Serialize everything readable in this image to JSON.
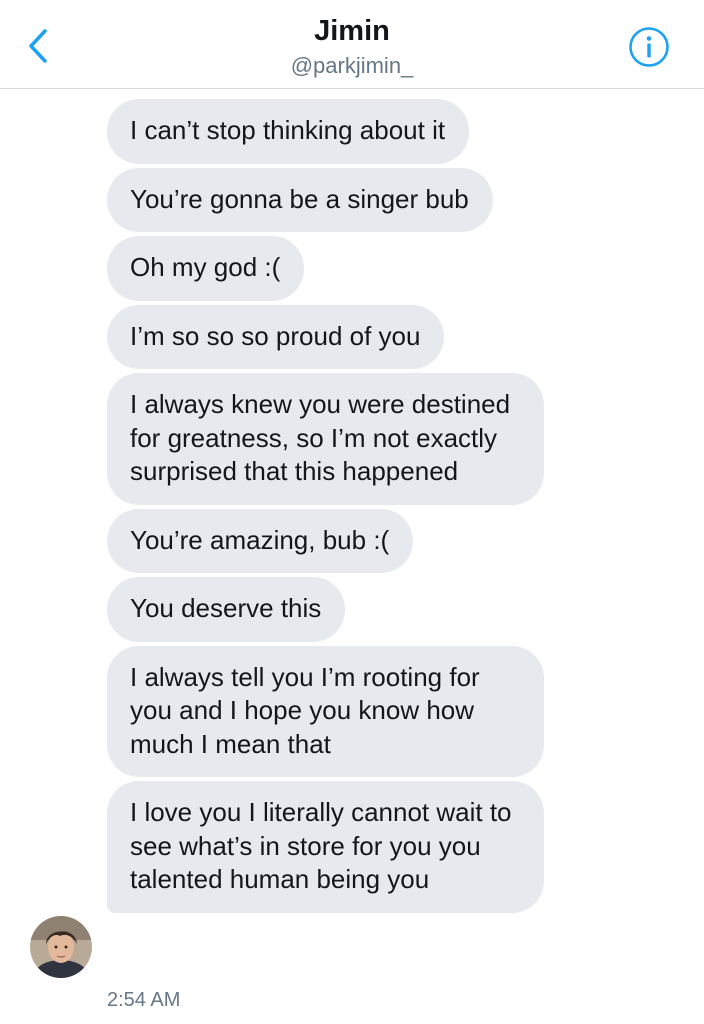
{
  "header": {
    "title": "Jimin",
    "handle": "@parkjimin_",
    "back_icon": "chevron-left-icon",
    "info_icon": "info-icon",
    "accent_color": "#1da1f2"
  },
  "messages": [
    {
      "text": "I can’t stop thinking about it"
    },
    {
      "text": "You’re gonna be a singer bub"
    },
    {
      "text": "Oh my god :("
    },
    {
      "text": "I’m so so so proud of you"
    },
    {
      "text": "I always knew you were destined for greatness, so I’m not exactly surprised that this happened"
    },
    {
      "text": "You’re amazing, bub :("
    },
    {
      "text": "You deserve this"
    },
    {
      "text": "I always tell you I’m rooting for you and I hope you know how much I mean that"
    },
    {
      "text": "I love you I literally cannot wait to see what’s in store for you you talented human being you"
    }
  ],
  "thread": {
    "timestamp": "2:54 AM",
    "bubble_color": "#e6e9ee"
  }
}
